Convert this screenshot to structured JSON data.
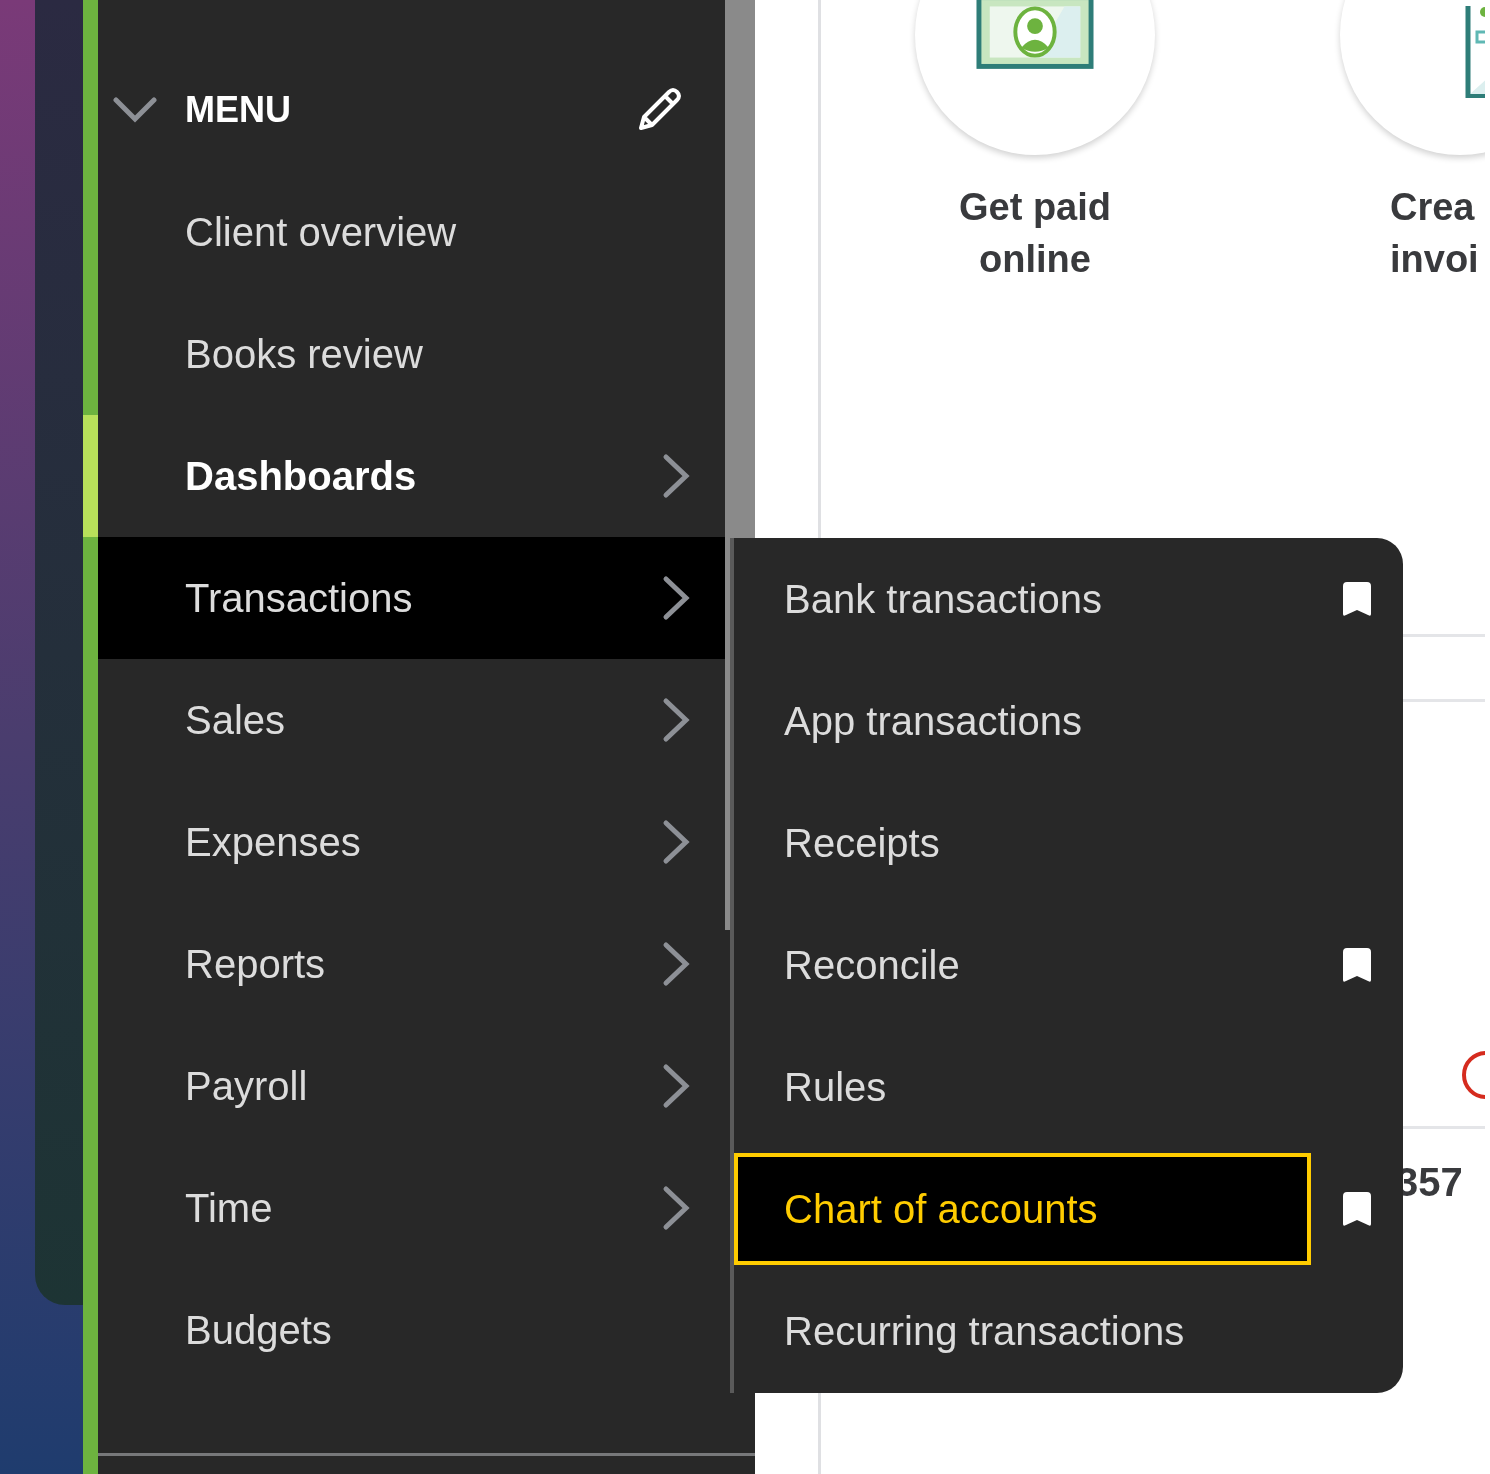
{
  "sidebar": {
    "header": {
      "label": "MENU",
      "expanded": true
    },
    "items": [
      {
        "kind": "header"
      },
      {
        "label": "Client overview",
        "has_submenu": false,
        "current": false,
        "selected": false
      },
      {
        "label": "Books review",
        "has_submenu": false,
        "current": false,
        "selected": false
      },
      {
        "label": "Dashboards",
        "has_submenu": true,
        "current": true,
        "selected": false
      },
      {
        "label": "Transactions",
        "has_submenu": true,
        "current": false,
        "selected": true
      },
      {
        "label": "Sales",
        "has_submenu": true,
        "current": false,
        "selected": false
      },
      {
        "label": "Expenses",
        "has_submenu": true,
        "current": false,
        "selected": false
      },
      {
        "label": "Reports",
        "has_submenu": true,
        "current": false,
        "selected": false
      },
      {
        "label": "Payroll",
        "has_submenu": true,
        "current": false,
        "selected": false
      },
      {
        "label": "Time",
        "has_submenu": true,
        "current": false,
        "selected": false
      },
      {
        "label": "Budgets",
        "has_submenu": false,
        "current": false,
        "selected": false
      }
    ]
  },
  "submenu": {
    "items": [
      {
        "label": "Bank transactions",
        "bookmarked": true,
        "selected": false
      },
      {
        "label": "App transactions",
        "bookmarked": false,
        "selected": false
      },
      {
        "label": "Receipts",
        "bookmarked": false,
        "selected": false
      },
      {
        "label": "Reconcile",
        "bookmarked": true,
        "selected": false
      },
      {
        "label": "Rules",
        "bookmarked": false,
        "selected": false
      },
      {
        "label": "Chart of accounts",
        "bookmarked": true,
        "selected": true
      },
      {
        "label": "Recurring transactions",
        "bookmarked": false,
        "selected": false
      }
    ]
  },
  "main": {
    "tiles": [
      {
        "kind": "money",
        "lines": [
          "Get paid",
          "online"
        ]
      },
      {
        "kind": "invoice",
        "lines": [
          "Crea",
          "invoi"
        ]
      }
    ],
    "figure": "357"
  }
}
